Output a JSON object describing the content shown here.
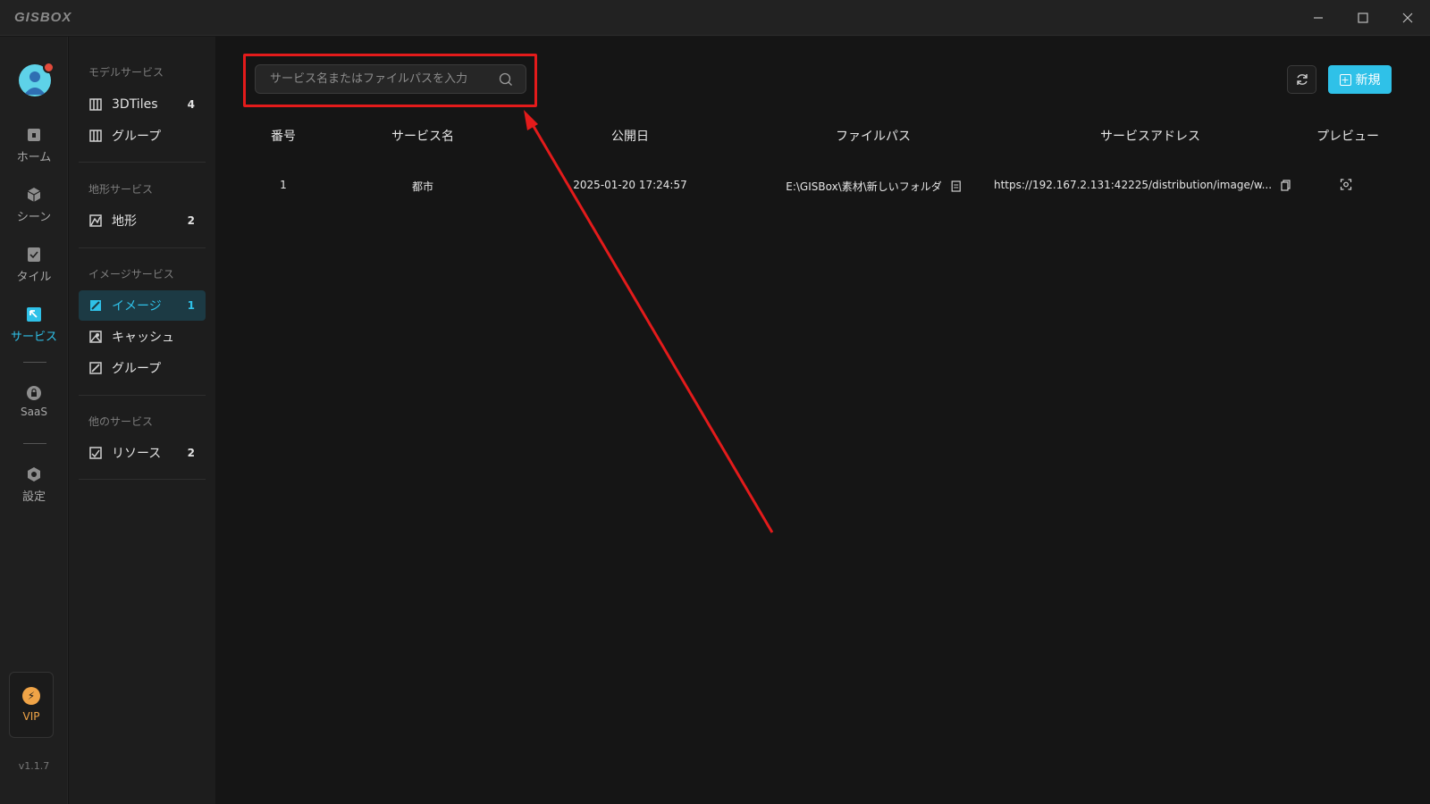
{
  "app": {
    "logo": "GISBOX",
    "version": "v1.1.7"
  },
  "window_controls": [
    "minimize-icon",
    "maximize-icon",
    "close-icon"
  ],
  "rail": {
    "items": [
      {
        "label": "ホーム",
        "icon": "home-icon"
      },
      {
        "label": "シーン",
        "icon": "cube-icon"
      },
      {
        "label": "タイル",
        "icon": "tile-icon"
      },
      {
        "label": "サービス",
        "icon": "service-icon",
        "active": true
      },
      {
        "label": "SaaS",
        "icon": "lock-icon"
      },
      {
        "label": "設定",
        "icon": "settings-icon"
      }
    ],
    "vip_label": "VIP"
  },
  "sidebar": {
    "groups": [
      {
        "title": "モデルサービス",
        "items": [
          {
            "label": "3DTiles",
            "count": "4"
          },
          {
            "label": "グループ",
            "count": ""
          }
        ]
      },
      {
        "title": "地形サービス",
        "items": [
          {
            "label": "地形",
            "count": "2"
          }
        ]
      },
      {
        "title": "イメージサービス",
        "items": [
          {
            "label": "イメージ",
            "count": "1",
            "active": true
          },
          {
            "label": "キャッシュ",
            "count": ""
          },
          {
            "label": "グループ",
            "count": ""
          }
        ]
      },
      {
        "title": "他のサービス",
        "items": [
          {
            "label": "リソース",
            "count": "2"
          }
        ]
      }
    ]
  },
  "search": {
    "placeholder": "サービス名またはファイルパスを入力",
    "value": ""
  },
  "toolbar": {
    "new_label": "新規"
  },
  "table": {
    "headers": [
      "番号",
      "サービス名",
      "公開日",
      "ファイルパス",
      "サービスアドレス",
      "プレビュー"
    ],
    "rows": [
      {
        "no": "1",
        "name": "都市",
        "date": "2025-01-20 17:24:57",
        "path": "E:\\GISBox\\素材\\新しいフォルダ",
        "address": "https://192.167.2.131:42225/distribution/image/w..."
      }
    ]
  },
  "colors": {
    "accent": "#2fc1e8",
    "highlight": "#e31b1b",
    "vip": "#f0a447"
  }
}
